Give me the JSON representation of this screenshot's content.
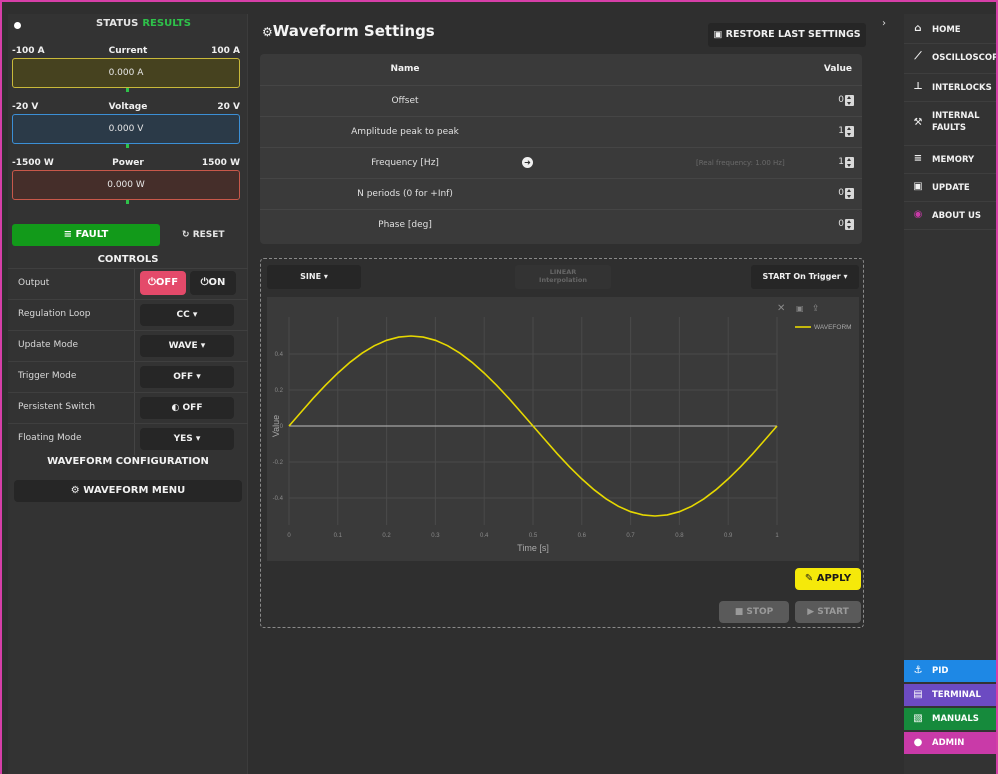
{
  "status": {
    "title": "STATUS",
    "state": "RESULTS"
  },
  "meters": [
    {
      "min": "-100 A",
      "name": "Current",
      "max": "100 A",
      "value": "0.000 A",
      "color": "#c9b93a"
    },
    {
      "min": "-20 V",
      "name": "Voltage",
      "max": "20 V",
      "value": "0.000 V",
      "color": "#3b8fd6"
    },
    {
      "min": "-1500 W",
      "name": "Power",
      "max": "1500 W",
      "value": "0.000 W",
      "color": "#c8584a"
    }
  ],
  "fault_label": "FAULT",
  "reset_label": "RESET",
  "controls": {
    "title": "CONTROLS",
    "output": {
      "label": "Output",
      "off": "OFF",
      "on": "ON"
    },
    "rows": [
      {
        "label": "Regulation Loop",
        "value": "CC"
      },
      {
        "label": "Update Mode",
        "value": "WAVE"
      },
      {
        "label": "Trigger Mode",
        "value": "OFF"
      },
      {
        "label": "Persistent Switch",
        "value": "OFF"
      },
      {
        "label": "Floating Mode",
        "value": "YES"
      }
    ]
  },
  "waveform_config": {
    "title": "WAVEFORM CONFIGURATION",
    "menu_label": "WAVEFORM MENU"
  },
  "waveform_settings": {
    "title": "Waveform Settings",
    "restore_label": "RESTORE LAST SETTINGS",
    "table_head": {
      "name": "Name",
      "value": "Value"
    },
    "params": [
      {
        "name": "Offset",
        "value": "0"
      },
      {
        "name": "Amplitude peak to peak",
        "value": "1"
      },
      {
        "name": "Frequency [Hz]",
        "value": "1",
        "note": "[Real frequency: 1.00 Hz]"
      },
      {
        "name": "N periods (0 for +Inf)",
        "value": "0"
      },
      {
        "name": "Phase [deg]",
        "value": "0"
      }
    ]
  },
  "wave_controls": {
    "shape": "SINE",
    "interp_line1": "LINEAR",
    "interp_line2": "Interpolation",
    "start_mode": "START On Trigger",
    "apply_label": "APPLY",
    "stop_label": "STOP",
    "start_label": "START"
  },
  "chart_data": {
    "type": "line",
    "xlabel": "Time [s]",
    "ylabel": "Value",
    "xlim": [
      0,
      1
    ],
    "ylim": [
      -0.55,
      0.55
    ],
    "xticks": [
      "0",
      "0.1",
      "0.2",
      "0.3",
      "0.4",
      "0.5",
      "0.6",
      "0.7",
      "0.8",
      "0.9",
      "1"
    ],
    "yticks": [
      0.4,
      0.2,
      0,
      -0.2,
      -0.4
    ],
    "ytick_labels": [
      "0.4",
      "0.2",
      "0",
      "-0.2",
      "-0.4"
    ],
    "grid": true,
    "legend": "top-right",
    "series": [
      {
        "name": "WAVEFORM",
        "color": "#e6d800",
        "x": [
          0,
          0.025,
          0.05,
          0.075,
          0.1,
          0.125,
          0.15,
          0.175,
          0.2,
          0.225,
          0.25,
          0.275,
          0.3,
          0.325,
          0.35,
          0.375,
          0.4,
          0.425,
          0.45,
          0.475,
          0.5,
          0.525,
          0.55,
          0.575,
          0.6,
          0.625,
          0.65,
          0.675,
          0.7,
          0.725,
          0.75,
          0.775,
          0.8,
          0.825,
          0.85,
          0.875,
          0.9,
          0.925,
          0.95,
          0.975,
          1
        ],
        "y": [
          0,
          0.078,
          0.155,
          0.227,
          0.294,
          0.354,
          0.405,
          0.446,
          0.476,
          0.494,
          0.5,
          0.494,
          0.476,
          0.446,
          0.405,
          0.354,
          0.294,
          0.227,
          0.155,
          0.078,
          0,
          -0.078,
          -0.155,
          -0.227,
          -0.294,
          -0.354,
          -0.405,
          -0.446,
          -0.476,
          -0.494,
          -0.5,
          -0.494,
          -0.476,
          -0.446,
          -0.405,
          -0.354,
          -0.294,
          -0.227,
          -0.155,
          -0.078,
          0
        ]
      }
    ]
  },
  "nav": {
    "top": [
      {
        "label": "HOME",
        "icon": "home-icon",
        "glyph": "⌂"
      },
      {
        "label": "OSCILLOSCOPE",
        "icon": "oscilloscope-icon",
        "glyph": "⟋"
      },
      {
        "label": "INTERLOCKS",
        "icon": "interlocks-icon",
        "glyph": "⊥"
      },
      {
        "label": "INTERNAL",
        "label2": "FAULTS",
        "icon": "wrench-icon",
        "glyph": "⚒"
      },
      {
        "label": "MEMORY",
        "icon": "memory-icon",
        "glyph": "≡"
      },
      {
        "label": "UPDATE",
        "icon": "update-icon",
        "glyph": "▣"
      },
      {
        "label": "ABOUT US",
        "icon": "about-icon",
        "glyph": "◉"
      }
    ],
    "bottom": [
      {
        "label": "PID",
        "icon": "pid-icon",
        "glyph": "⚓",
        "color": "#1e88e5"
      },
      {
        "label": "TERMINAL",
        "icon": "terminal-icon",
        "glyph": "▤",
        "color": "#6c4bc2"
      },
      {
        "label": "MANUALS",
        "icon": "manuals-icon",
        "glyph": "▧",
        "color": "#168a3c"
      },
      {
        "label": "ADMIN",
        "icon": "admin-icon",
        "glyph": "●",
        "color": "#c93aa8"
      }
    ]
  }
}
